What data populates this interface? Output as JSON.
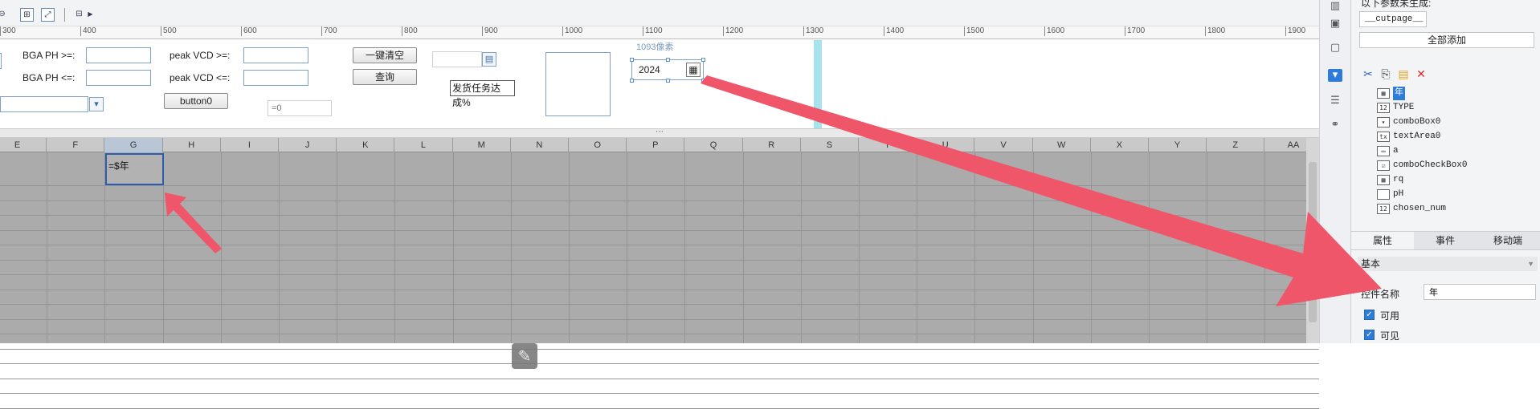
{
  "toolbar": {
    "buttons": [
      "⊞",
      "⤢",
      "⊟"
    ],
    "icon_names": [
      "grid-icon",
      "fit-icon",
      "preview-icon"
    ]
  },
  "ruler": {
    "ticks": [
      "300",
      "400",
      "500",
      "600",
      "700",
      "800",
      "900",
      "1000",
      "1100",
      "1200",
      "1300",
      "1400",
      "1500",
      "1600",
      "1700",
      "1800",
      "1900"
    ]
  },
  "form": {
    "bga_ge_label": "BGA PH >=:",
    "bga_le_label": "BGA PH <=:",
    "vcd_ge_label": "peak VCD >=:",
    "vcd_le_label": "peak VCD <=:",
    "clear_button": "一键清空",
    "query_button": "查询",
    "button0_label": "button0",
    "eq_placeholder": "=0",
    "task_label": "发货任务达成%",
    "size_hint": "1093像素",
    "year_value": "2024"
  },
  "grid": {
    "columns": [
      "E",
      "F",
      "G",
      "H",
      "I",
      "J",
      "K",
      "L",
      "M",
      "N",
      "O",
      "P",
      "Q",
      "R",
      "S",
      "T",
      "U",
      "V",
      "W",
      "X",
      "Y",
      "Z",
      "AA"
    ],
    "selected_column": "G",
    "selected_cell_formula": "=$年"
  },
  "panel": {
    "param_note": "以下参数未生成:",
    "cutpage_param": "__cutpage__",
    "add_all_button": "全部添加",
    "tree_items": [
      {
        "icon": "▦",
        "label": "年"
      },
      {
        "icon": "12",
        "label": "TYPE"
      },
      {
        "icon": "▾",
        "label": "comboBox0"
      },
      {
        "icon": "tx",
        "label": "textArea0"
      },
      {
        "icon": "▭",
        "label": "a"
      },
      {
        "icon": "☑",
        "label": "comboCheckBox0"
      },
      {
        "icon": "▦",
        "label": "rq"
      },
      {
        "icon": "",
        "label": "pH"
      },
      {
        "icon": "12",
        "label": "chosen_num"
      }
    ],
    "tabs": [
      "属性",
      "事件",
      "移动端"
    ],
    "section_basic": "基本",
    "widget_name_label": "控件名称",
    "widget_name_value": "年",
    "enabled_label": "可用",
    "visible_label": "可见"
  },
  "colors": {
    "accent": "#2f7bd9",
    "annotation_arrow": "#f0566a",
    "guide": "#a6e3ee"
  }
}
